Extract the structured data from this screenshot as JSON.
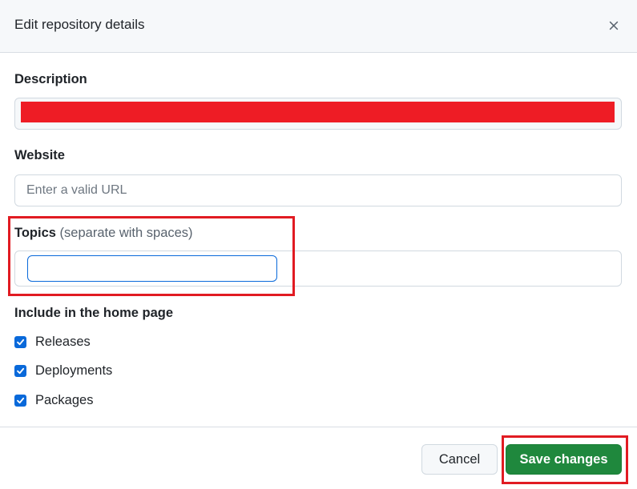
{
  "dialog": {
    "title": "Edit repository details",
    "close_icon": "close-icon"
  },
  "description": {
    "label": "Description",
    "value": ""
  },
  "website": {
    "label": "Website",
    "placeholder": "Enter a valid URL"
  },
  "topics": {
    "label": "Topics",
    "hint": "(separate with spaces)",
    "value": ""
  },
  "home_page": {
    "label": "Include in the home page",
    "options": [
      {
        "label": "Releases",
        "checked": true
      },
      {
        "label": "Deployments",
        "checked": true
      },
      {
        "label": "Packages",
        "checked": true
      }
    ]
  },
  "footer": {
    "cancel_label": "Cancel",
    "save_label": "Save changes"
  },
  "colors": {
    "primary_button": "#1f883d",
    "checkbox": "#0969da",
    "focus_border": "#0969da",
    "annotation_red": "#e11b22",
    "redaction_red": "#ee1c25"
  }
}
